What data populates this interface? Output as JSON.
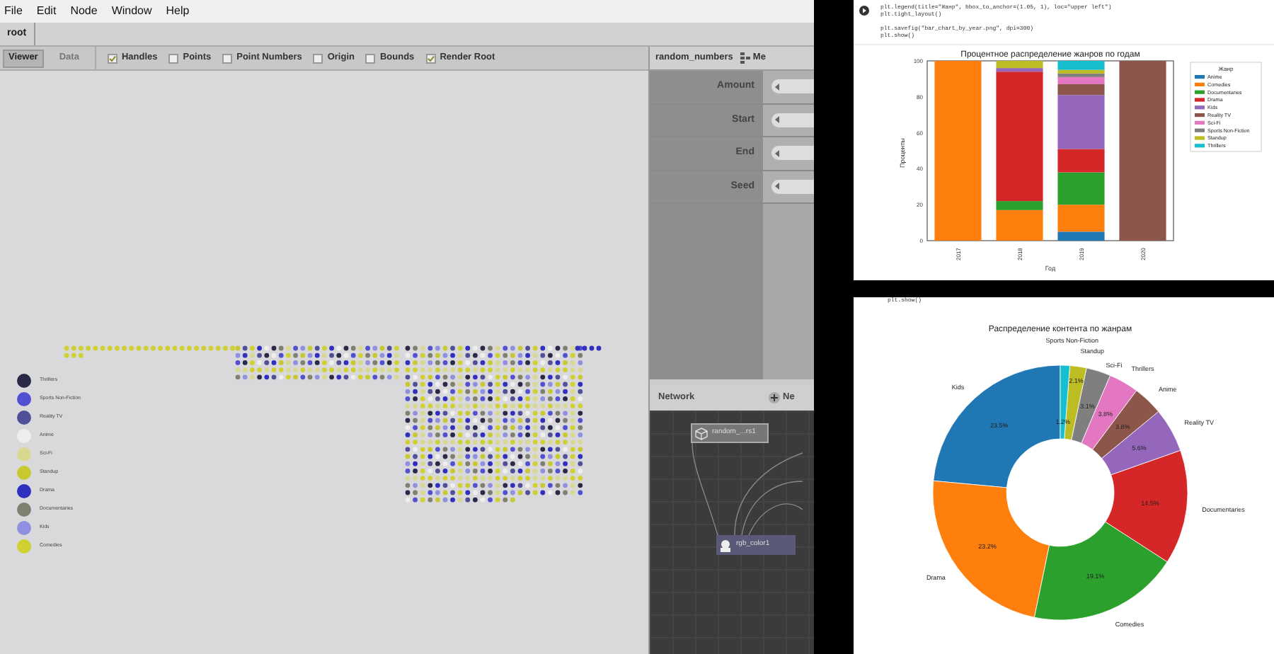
{
  "menu": [
    "File",
    "Edit",
    "Node",
    "Window",
    "Help"
  ],
  "breadcrumb": "root",
  "viewer_tabs": [
    {
      "label": "Viewer",
      "selected": true
    },
    {
      "label": "Data",
      "selected": false
    }
  ],
  "viewer_options": [
    {
      "label": "Handles",
      "checked": true
    },
    {
      "label": "Points",
      "checked": false
    },
    {
      "label": "Point Numbers",
      "checked": false
    },
    {
      "label": "Origin",
      "checked": false
    },
    {
      "label": "Bounds",
      "checked": false
    },
    {
      "label": "Render Root",
      "checked": true
    }
  ],
  "legend": [
    {
      "label": "Thrillers",
      "color": "#2a2a48"
    },
    {
      "label": "Sports Non-Fiction",
      "color": "#5050d0"
    },
    {
      "label": "Reality TV",
      "color": "#505098"
    },
    {
      "label": "Anime",
      "color": "#eeeeee"
    },
    {
      "label": "Sci-Fi",
      "color": "#d8d890"
    },
    {
      "label": "Standup",
      "color": "#c8c830"
    },
    {
      "label": "Drama",
      "color": "#3030c0"
    },
    {
      "label": "Documentaries",
      "color": "#808070"
    },
    {
      "label": "Kids",
      "color": "#9090e0"
    },
    {
      "label": "Comedies",
      "color": "#d0d030"
    }
  ],
  "params_panel": {
    "title": "random_numbers",
    "tab": "Me",
    "params": [
      "Amount",
      "Start",
      "End",
      "Seed"
    ]
  },
  "network": {
    "title": "Network",
    "add_button": "Ne",
    "nodes": [
      "random_...rs1",
      "rgb_color1"
    ]
  },
  "notebook_top": {
    "code": [
      [
        "plt.legend(title=\"Жанр\", bbox_to_anchor=(1.05, 1), loc=\"upper left\")",
        "plt.tight_layout()"
      ],
      [
        "plt.savefig(\"bar_chart_by_year.png\", dpi=300)",
        "plt.show()"
      ]
    ],
    "chart_data": {
      "type": "bar",
      "stacked": true,
      "title": "Процентное распределение жанров по годам",
      "xlabel": "Год",
      "ylabel": "Проценты",
      "legend": {
        "title": "Жанр"
      },
      "categories": [
        "2017",
        "2018",
        "2019",
        "2020"
      ],
      "ylim": [
        0,
        100
      ],
      "yticks": [
        0,
        20,
        40,
        60,
        80,
        100
      ],
      "series": [
        {
          "name": "Anime",
          "color": "#1f77b4",
          "values": [
            0,
            0,
            5,
            0
          ]
        },
        {
          "name": "Comedies",
          "color": "#ff7f0e",
          "values": [
            100,
            17,
            15,
            0
          ]
        },
        {
          "name": "Documentaries",
          "color": "#2ca02c",
          "values": [
            0,
            5,
            18,
            0
          ]
        },
        {
          "name": "Drama",
          "color": "#d62728",
          "values": [
            0,
            72,
            13,
            0
          ]
        },
        {
          "name": "Kids",
          "color": "#9467bd",
          "values": [
            0,
            2,
            30,
            0
          ]
        },
        {
          "name": "Reality TV",
          "color": "#8c564b",
          "values": [
            0,
            0,
            6,
            100
          ]
        },
        {
          "name": "Sci-Fi",
          "color": "#e377c2",
          "values": [
            0,
            0,
            4,
            0
          ]
        },
        {
          "name": "Sports Non-Fiction",
          "color": "#7f7f7f",
          "values": [
            0,
            0,
            2,
            0
          ]
        },
        {
          "name": "Standup",
          "color": "#bcbd22",
          "values": [
            0,
            4,
            2,
            0
          ]
        },
        {
          "name": "Thrillers",
          "color": "#17becf",
          "values": [
            0,
            0,
            5,
            0
          ]
        }
      ]
    }
  },
  "notebook_bottom": {
    "code": [
      [
        "plt.show()"
      ]
    ],
    "chart_data": {
      "type": "donut",
      "title": "Распределение контента по жанрам",
      "categories": [
        "Kids",
        "Drama",
        "Comedies",
        "Documentaries",
        "Reality TV",
        "Anime",
        "Thrillers",
        "Sci-Fi",
        "Standup",
        "Sports Non-Fiction"
      ],
      "values": [
        23.5,
        23.2,
        19.1,
        14.5,
        5.6,
        3.8,
        3.8,
        3.1,
        2.1,
        1.2
      ],
      "value_labels": [
        "23.5%",
        "23.2%",
        "19.1%",
        "14.5%",
        "5.6%",
        "3.8%",
        "3.8%",
        "3.1%",
        "2.1%",
        "1.2%"
      ]
    }
  }
}
